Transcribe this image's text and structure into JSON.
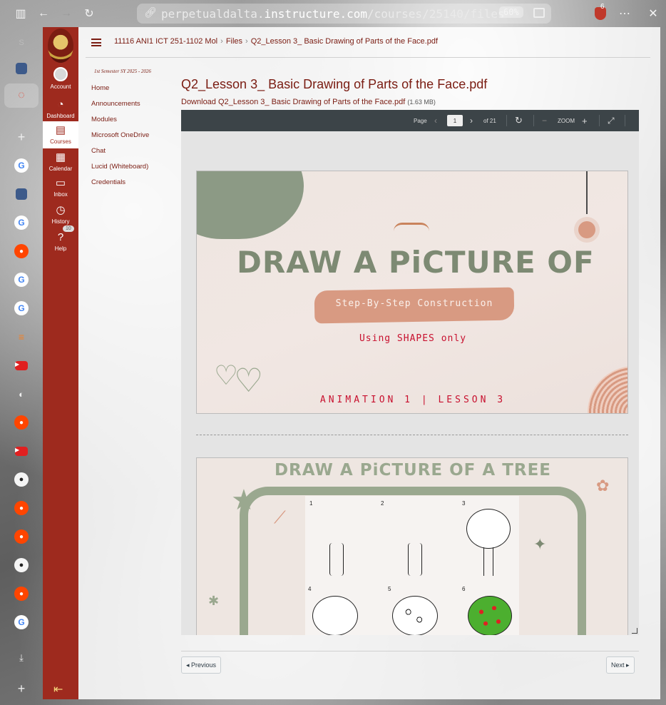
{
  "browser": {
    "url_prefix": "perpetualdalta.",
    "url_domain": "instructure.com",
    "url_path": "/courses/25140/files",
    "zoom": "60%",
    "extension_badge": "6",
    "sidebar_letter": "S"
  },
  "global_nav": {
    "items": [
      {
        "label": "Account",
        "icon": "account-icon"
      },
      {
        "label": "Dashboard",
        "icon": "dashboard-icon"
      },
      {
        "label": "Courses",
        "icon": "courses-icon"
      },
      {
        "label": "Calendar",
        "icon": "calendar-icon"
      },
      {
        "label": "Inbox",
        "icon": "inbox-icon"
      },
      {
        "label": "History",
        "icon": "history-icon"
      },
      {
        "label": "Help",
        "icon": "help-icon"
      }
    ],
    "help_badge": "10"
  },
  "breadcrumb": {
    "course": "11116 ANI1 ICT 251-1102 Mol",
    "files": "Files",
    "file": "Q2_Lesson 3_ Basic Drawing of Parts of the Face.pdf"
  },
  "course_nav": {
    "term": "1st Semester SY 2025 - 2026",
    "items": [
      "Home",
      "Announcements",
      "Modules",
      "Microsoft OneDrive",
      "Chat",
      "Lucid (Whiteboard)",
      "Credentials"
    ]
  },
  "file": {
    "title": "Q2_Lesson 3_ Basic Drawing of Parts of the Face.pdf",
    "download_label": "Download Q2_Lesson 3_ Basic Drawing of Parts of the Face.pdf",
    "size": "(1.63 MB)"
  },
  "viewer": {
    "page_label": "Page",
    "current_page": "1",
    "of_pages": "of 21",
    "zoom_label": "ZOOM"
  },
  "slide1": {
    "title": "DRAW A PiCTURE OF",
    "subtitle": "Step-By-Step Construction",
    "shapes_line": "Using SHAPES only",
    "lesson_line": "ANIMATION 1 | LESSON 3"
  },
  "slide2": {
    "title": "DRAW A PiCTURE OF A TREE",
    "steps": [
      "1",
      "2",
      "3",
      "4",
      "5",
      "6"
    ]
  },
  "pager": {
    "previous": "Previous",
    "next": "Next"
  },
  "colors": {
    "brand": "#9e2a1e",
    "sage": "#7d8a73",
    "accent_red": "#c8102e"
  }
}
